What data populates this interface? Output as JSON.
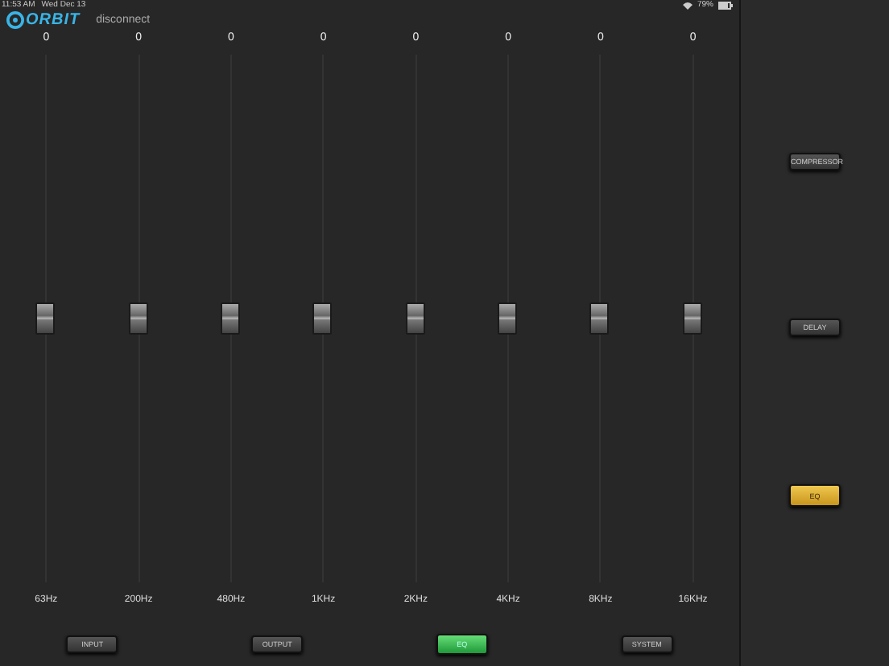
{
  "status_bar": {
    "time": "11:53 AM",
    "date": "Wed Dec 13",
    "battery": "79%"
  },
  "header": {
    "logo": "ORBIT",
    "link": "disconnect"
  },
  "bands": [
    {
      "value": "0",
      "label": "63Hz",
      "level": 0.5
    },
    {
      "value": "0",
      "label": "200Hz",
      "level": 0.5
    },
    {
      "value": "0",
      "label": "480Hz",
      "level": 0.5
    },
    {
      "value": "0",
      "label": "1KHz",
      "level": 0.5
    },
    {
      "value": "0",
      "label": "2KHz",
      "level": 0.5
    },
    {
      "value": "0",
      "label": "4KHz",
      "level": 0.5
    },
    {
      "value": "0",
      "label": "8KHz",
      "level": 0.5
    },
    {
      "value": "0",
      "label": "16KHz",
      "level": 0.5
    }
  ],
  "bottom_tabs": [
    {
      "label": "INPUT",
      "selected": false
    },
    {
      "label": "OUTPUT",
      "selected": false
    },
    {
      "label": "EQ",
      "selected": true
    },
    {
      "label": "SYSTEM",
      "selected": false
    }
  ],
  "side_buttons": [
    {
      "label": "COMPRESSOR",
      "selected": false
    },
    {
      "label": "DELAY",
      "selected": false
    },
    {
      "label": "EQ",
      "selected": true
    }
  ]
}
